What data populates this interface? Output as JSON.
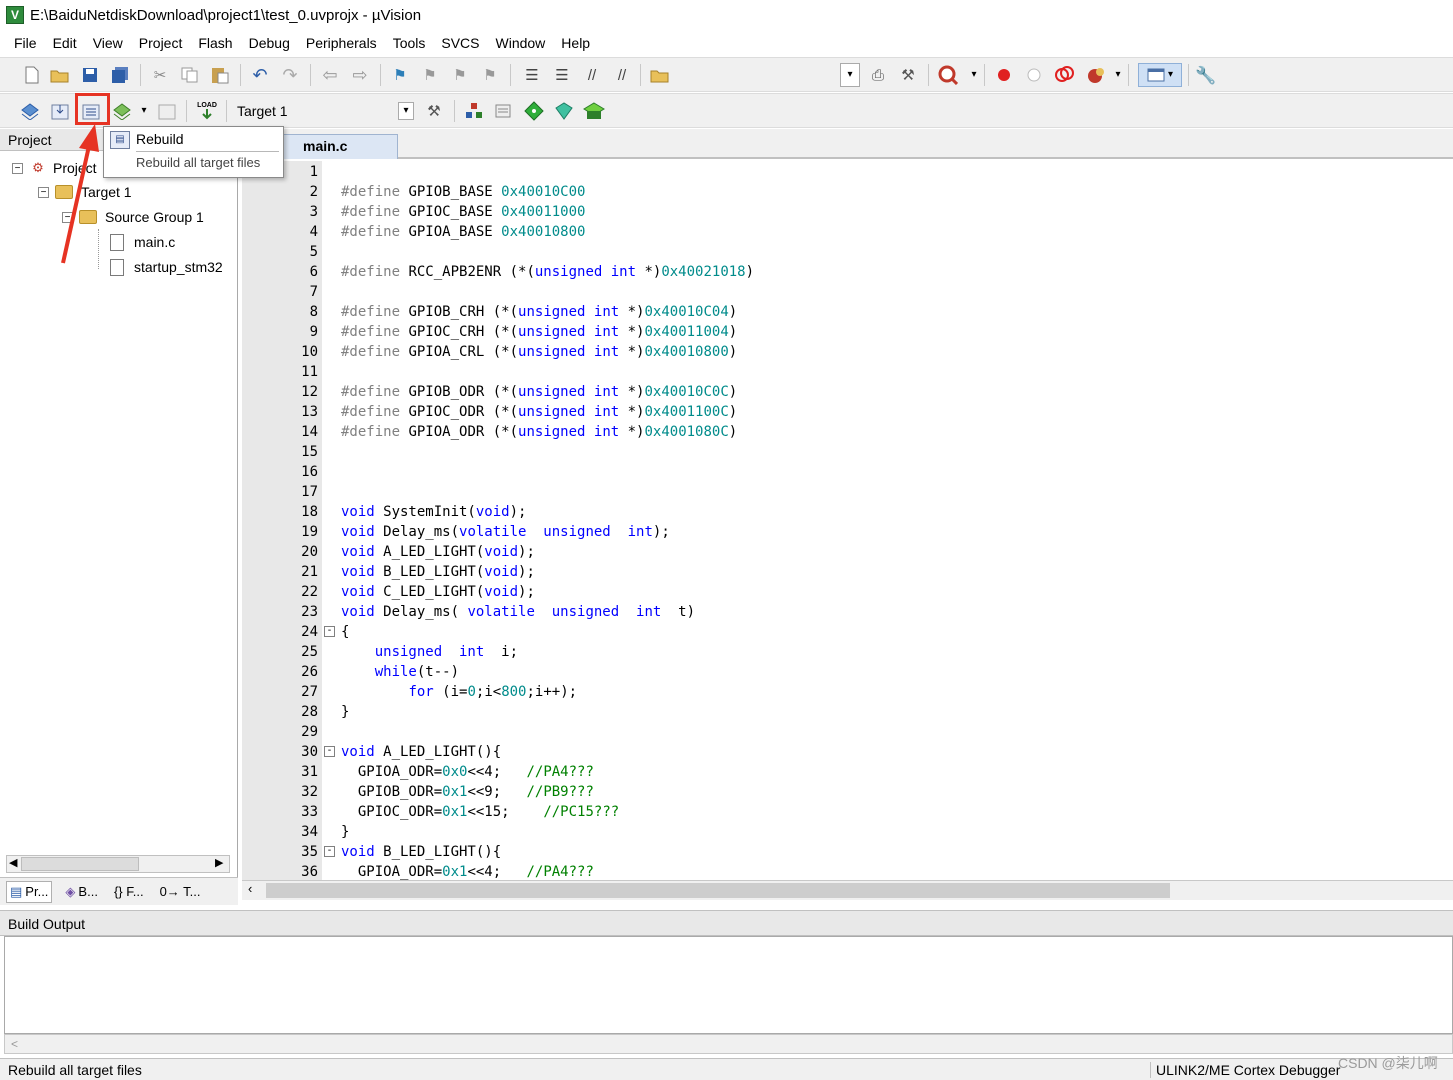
{
  "window": {
    "title": "E:\\BaiduNetdiskDownload\\project1\\test_0.uvprojx - µVision",
    "app_icon": "V"
  },
  "menu": [
    "File",
    "Edit",
    "View",
    "Project",
    "Flash",
    "Debug",
    "Peripherals",
    "Tools",
    "SVCS",
    "Window",
    "Help"
  ],
  "toolbar2": {
    "target_select": "Target 1",
    "load_label": "LOAD"
  },
  "tooltip": {
    "title": "Rebuild",
    "description": "Rebuild all target files"
  },
  "project_panel": {
    "header": "Project",
    "tree": {
      "root": "Project",
      "target": "Target 1",
      "group": "Source Group 1",
      "files": [
        "main.c",
        "startup_stm32"
      ]
    },
    "tabs": [
      "Pr...",
      "B...",
      "{} F...",
      "0→ T..."
    ]
  },
  "editor": {
    "tab": "main.c",
    "lines": [
      {
        "n": "1",
        "fold": "",
        "segs": []
      },
      {
        "n": "2",
        "fold": "",
        "segs": [
          [
            "pp",
            "#define"
          ],
          [
            "t",
            " GPIOB_BASE "
          ],
          [
            "num",
            "0x40010C00"
          ]
        ]
      },
      {
        "n": "3",
        "fold": "",
        "segs": [
          [
            "pp",
            "#define"
          ],
          [
            "t",
            " GPIOC_BASE "
          ],
          [
            "num",
            "0x40011000"
          ]
        ]
      },
      {
        "n": "4",
        "fold": "",
        "segs": [
          [
            "pp",
            "#define"
          ],
          [
            "t",
            " GPIOA_BASE "
          ],
          [
            "num",
            "0x40010800"
          ]
        ]
      },
      {
        "n": "5",
        "fold": "",
        "segs": []
      },
      {
        "n": "6",
        "fold": "",
        "segs": [
          [
            "pp",
            "#define"
          ],
          [
            "t",
            " RCC_APB2ENR (*("
          ],
          [
            "kw",
            "unsigned int"
          ],
          [
            "t",
            " *)"
          ],
          [
            "num",
            "0x40021018"
          ],
          [
            "t",
            ")"
          ]
        ]
      },
      {
        "n": "7",
        "fold": "",
        "segs": []
      },
      {
        "n": "8",
        "fold": "",
        "segs": [
          [
            "pp",
            "#define"
          ],
          [
            "t",
            " GPIOB_CRH (*("
          ],
          [
            "kw",
            "unsigned int"
          ],
          [
            "t",
            " *)"
          ],
          [
            "num",
            "0x40010C04"
          ],
          [
            "t",
            ")"
          ]
        ]
      },
      {
        "n": "9",
        "fold": "",
        "segs": [
          [
            "pp",
            "#define"
          ],
          [
            "t",
            " GPIOC_CRH (*("
          ],
          [
            "kw",
            "unsigned int"
          ],
          [
            "t",
            " *)"
          ],
          [
            "num",
            "0x40011004"
          ],
          [
            "t",
            ")"
          ]
        ]
      },
      {
        "n": "10",
        "fold": "",
        "segs": [
          [
            "pp",
            "#define"
          ],
          [
            "t",
            " GPIOA_CRL (*("
          ],
          [
            "kw",
            "unsigned int"
          ],
          [
            "t",
            " *)"
          ],
          [
            "num",
            "0x40010800"
          ],
          [
            "t",
            ")"
          ]
        ]
      },
      {
        "n": "11",
        "fold": "",
        "segs": []
      },
      {
        "n": "12",
        "fold": "",
        "segs": [
          [
            "pp",
            "#define"
          ],
          [
            "t",
            " GPIOB_ODR (*("
          ],
          [
            "kw",
            "unsigned int"
          ],
          [
            "t",
            " *)"
          ],
          [
            "num",
            "0x40010C0C"
          ],
          [
            "t",
            ")"
          ]
        ]
      },
      {
        "n": "13",
        "fold": "",
        "segs": [
          [
            "pp",
            "#define"
          ],
          [
            "t",
            " GPIOC_ODR (*("
          ],
          [
            "kw",
            "unsigned int"
          ],
          [
            "t",
            " *)"
          ],
          [
            "num",
            "0x4001100C"
          ],
          [
            "t",
            ")"
          ]
        ]
      },
      {
        "n": "14",
        "fold": "",
        "segs": [
          [
            "pp",
            "#define"
          ],
          [
            "t",
            " GPIOA_ODR (*("
          ],
          [
            "kw",
            "unsigned int"
          ],
          [
            "t",
            " *)"
          ],
          [
            "num",
            "0x4001080C"
          ],
          [
            "t",
            ")"
          ]
        ]
      },
      {
        "n": "15",
        "fold": "",
        "segs": []
      },
      {
        "n": "16",
        "fold": "",
        "segs": []
      },
      {
        "n": "17",
        "fold": "",
        "segs": []
      },
      {
        "n": "18",
        "fold": "",
        "segs": [
          [
            "kw",
            "void"
          ],
          [
            "t",
            " SystemInit("
          ],
          [
            "kw",
            "void"
          ],
          [
            "t",
            ");"
          ]
        ]
      },
      {
        "n": "19",
        "fold": "",
        "segs": [
          [
            "kw",
            "void"
          ],
          [
            "t",
            " Delay_ms("
          ],
          [
            "kw",
            "volatile  unsigned  int"
          ],
          [
            "t",
            ");"
          ]
        ]
      },
      {
        "n": "20",
        "fold": "",
        "segs": [
          [
            "kw",
            "void"
          ],
          [
            "t",
            " A_LED_LIGHT("
          ],
          [
            "kw",
            "void"
          ],
          [
            "t",
            ");"
          ]
        ]
      },
      {
        "n": "21",
        "fold": "",
        "segs": [
          [
            "kw",
            "void"
          ],
          [
            "t",
            " B_LED_LIGHT("
          ],
          [
            "kw",
            "void"
          ],
          [
            "t",
            ");"
          ]
        ]
      },
      {
        "n": "22",
        "fold": "",
        "segs": [
          [
            "kw",
            "void"
          ],
          [
            "t",
            " C_LED_LIGHT("
          ],
          [
            "kw",
            "void"
          ],
          [
            "t",
            ");"
          ]
        ]
      },
      {
        "n": "23",
        "fold": "",
        "segs": [
          [
            "kw",
            "void"
          ],
          [
            "t",
            " Delay_ms( "
          ],
          [
            "kw",
            "volatile  unsigned  int"
          ],
          [
            "t",
            "  t)"
          ]
        ]
      },
      {
        "n": "24",
        "fold": "-",
        "segs": [
          [
            "t",
            "{"
          ]
        ]
      },
      {
        "n": "25",
        "fold": "",
        "segs": [
          [
            "t",
            "    "
          ],
          [
            "kw",
            "unsigned  int"
          ],
          [
            "t",
            "  i;"
          ]
        ]
      },
      {
        "n": "26",
        "fold": "",
        "segs": [
          [
            "t",
            "    "
          ],
          [
            "kw",
            "while"
          ],
          [
            "t",
            "(t--)"
          ]
        ]
      },
      {
        "n": "27",
        "fold": "",
        "segs": [
          [
            "t",
            "        "
          ],
          [
            "kw",
            "for"
          ],
          [
            "t",
            " (i="
          ],
          [
            "num",
            "0"
          ],
          [
            "t",
            ";i<"
          ],
          [
            "num",
            "800"
          ],
          [
            "t",
            ";i++);"
          ]
        ]
      },
      {
        "n": "28",
        "fold": "",
        "segs": [
          [
            "t",
            "}"
          ]
        ]
      },
      {
        "n": "29",
        "fold": "",
        "segs": []
      },
      {
        "n": "30",
        "fold": "-",
        "segs": [
          [
            "kw",
            "void"
          ],
          [
            "t",
            " A_LED_LIGHT(){"
          ]
        ]
      },
      {
        "n": "31",
        "fold": "",
        "segs": [
          [
            "t",
            "  GPIOA_ODR="
          ],
          [
            "num",
            "0x0"
          ],
          [
            "t",
            "<<4;   "
          ],
          [
            "cmt",
            "//PA4???"
          ]
        ]
      },
      {
        "n": "32",
        "fold": "",
        "segs": [
          [
            "t",
            "  GPIOB_ODR="
          ],
          [
            "num",
            "0x1"
          ],
          [
            "t",
            "<<9;   "
          ],
          [
            "cmt",
            "//PB9???"
          ]
        ]
      },
      {
        "n": "33",
        "fold": "",
        "segs": [
          [
            "t",
            "  GPIOC_ODR="
          ],
          [
            "num",
            "0x1"
          ],
          [
            "t",
            "<<15;    "
          ],
          [
            "cmt",
            "//PC15???"
          ]
        ]
      },
      {
        "n": "34",
        "fold": "",
        "segs": [
          [
            "t",
            "}"
          ]
        ]
      },
      {
        "n": "35",
        "fold": "-",
        "segs": [
          [
            "kw",
            "void"
          ],
          [
            "t",
            " B_LED_LIGHT(){"
          ]
        ]
      },
      {
        "n": "36",
        "fold": "",
        "segs": [
          [
            "t",
            "  GPIOA_ODR="
          ],
          [
            "num",
            "0x1"
          ],
          [
            "t",
            "<<4;   "
          ],
          [
            "cmt",
            "//PA4???"
          ]
        ]
      }
    ]
  },
  "build_output": {
    "header": "Build Output",
    "scroll_arrow": "<"
  },
  "status": {
    "left": "Rebuild all target files",
    "right": "ULINK2/ME Cortex Debugger",
    "watermark": "CSDN @柒儿啊"
  },
  "colors": {
    "keyword": "#0000ff",
    "number": "#008b8b",
    "comment": "#008000",
    "preprocessor": "#808080",
    "highlight": "#e63323"
  },
  "icons": [
    "new-file-icon",
    "open-folder-icon",
    "save-icon",
    "save-all-icon",
    "cut-icon",
    "copy-icon",
    "paste-icon",
    "undo-icon",
    "redo-icon",
    "back-icon",
    "forward-icon",
    "bookmark-icon",
    "indent-icon",
    "outdent-icon",
    "comment-icon",
    "uncomment-icon",
    "find-in-files-icon",
    "debug-icon",
    "breakpoint-icon",
    "window-layout-icon",
    "wrench-icon",
    "translate-icon",
    "build-icon",
    "rebuild-icon",
    "batch-build-icon",
    "stop-build-icon",
    "download-icon",
    "options-icon",
    "manage-components-icon"
  ]
}
